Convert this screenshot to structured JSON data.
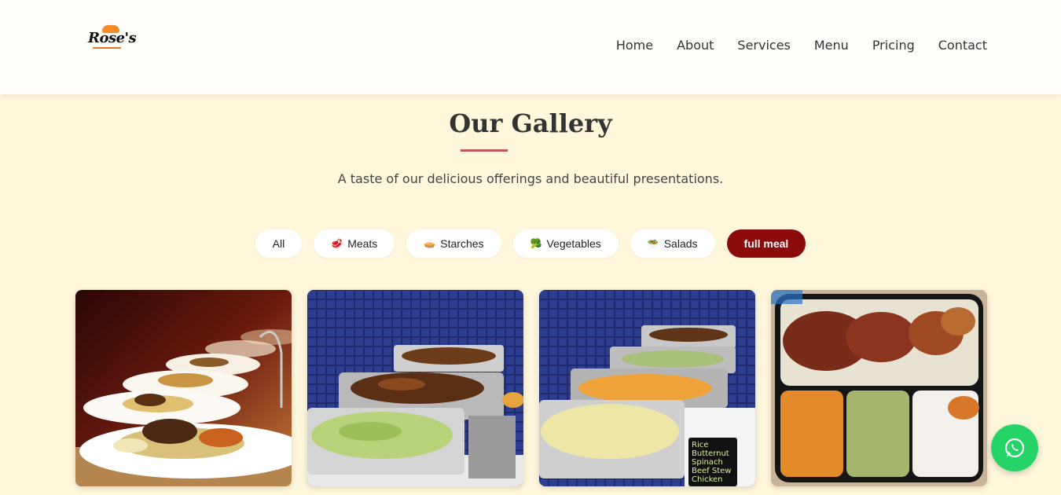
{
  "header": {
    "logo_text": "Rose's",
    "nav": [
      "Home",
      "About",
      "Services",
      "Menu",
      "Pricing",
      "Contact"
    ]
  },
  "gallery": {
    "title": "Our Gallery",
    "subtitle": "A taste of our delicious offerings and beautiful presentations.",
    "filters": [
      {
        "label": "All",
        "icon": "",
        "active": false
      },
      {
        "label": "Meats",
        "icon": "meat-icon",
        "glyph": "🥩",
        "active": false
      },
      {
        "label": "Starches",
        "icon": "pie-icon",
        "glyph": "🥧",
        "active": false
      },
      {
        "label": "Vegetables",
        "icon": "broccoli-icon",
        "glyph": "🥦",
        "active": false
      },
      {
        "label": "Salads",
        "icon": "salad-icon",
        "glyph": "🥗",
        "active": false
      },
      {
        "label": "full meal",
        "icon": "",
        "active": true
      }
    ],
    "images": [
      {
        "name": "plated-meals-photo"
      },
      {
        "name": "buffet-stew-and-spinach-photo"
      },
      {
        "name": "buffet-rice-and-butternut-photo",
        "sign_text": "Rice Butternut Spinach Beef Stew Chicken"
      },
      {
        "name": "takeaway-meal-box-photo"
      }
    ]
  },
  "colors": {
    "background": "#fff7dc",
    "accent": "#8b0a0a",
    "underline": "#c0585a",
    "whatsapp": "#25d366"
  }
}
